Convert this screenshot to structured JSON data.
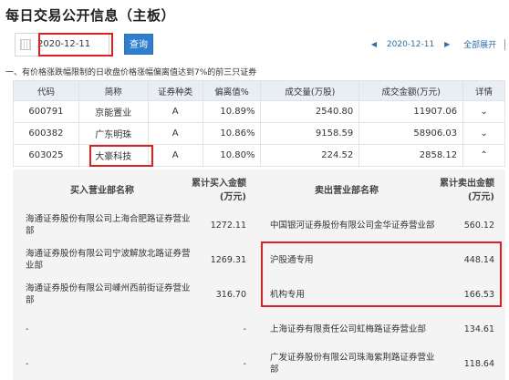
{
  "page_title": "每日交易公开信息（主板）",
  "toolbar": {
    "date_value": "2020-12-11",
    "query_label": "查询",
    "nav_date": "2020-12-11",
    "expand_all": "全部展开"
  },
  "note": "一、有价格涨跌幅限制的日收盘价格涨幅偏离值达到7%的前三只证券",
  "main_table": {
    "headers": [
      "代码",
      "简称",
      "证券种类",
      "偏离值%",
      "成交量(万股)",
      "成交金额(万元)",
      "详情"
    ],
    "rows": [
      {
        "code": "600791",
        "name": "京能置业",
        "type": "A",
        "deviation": "10.89%",
        "volume": "2540.80",
        "amount": "11907.06"
      },
      {
        "code": "600382",
        "name": "广东明珠",
        "type": "A",
        "deviation": "10.86%",
        "volume": "9158.59",
        "amount": "58906.03"
      },
      {
        "code": "603025",
        "name": "大豪科技",
        "type": "A",
        "deviation": "10.80%",
        "volume": "224.52",
        "amount": "2858.12"
      }
    ]
  },
  "detail": {
    "headers": {
      "buy_dept": "买入营业部名称",
      "buy_amount_line1": "累计买入金额",
      "buy_amount_line2": "(万元)",
      "sell_dept": "卖出营业部名称",
      "sell_amount_line1": "累计卖出金额",
      "sell_amount_line2": "(万元)"
    },
    "rows": [
      {
        "buy_dept": "海通证券股份有限公司上海合肥路证券营业部",
        "buy_amount": "1272.11",
        "sell_dept": "中国银河证券股份有限公司金华证券营业部",
        "sell_amount": "560.12"
      },
      {
        "buy_dept": "海通证券股份有限公司宁波解放北路证券营业部",
        "buy_amount": "1269.31",
        "sell_dept": "沪股通专用",
        "sell_amount": "448.14"
      },
      {
        "buy_dept": "海通证券股份有限公司嵊州西前街证券营业部",
        "buy_amount": "316.70",
        "sell_dept": "机构专用",
        "sell_amount": "166.53"
      },
      {
        "buy_dept": "-",
        "buy_amount": "-",
        "sell_dept": "上海证券有限责任公司虹梅路证券营业部",
        "sell_amount": "134.61"
      },
      {
        "buy_dept": "-",
        "buy_amount": "-",
        "sell_dept": "广发证券股份有限公司珠海紫荆路证券营业部",
        "sell_amount": "118.64"
      }
    ]
  },
  "colors": {
    "accent": "#2f7fd0",
    "highlight": "#e02020",
    "header_bg": "#e9eef5",
    "detail_bg": "#f4f4f4"
  }
}
